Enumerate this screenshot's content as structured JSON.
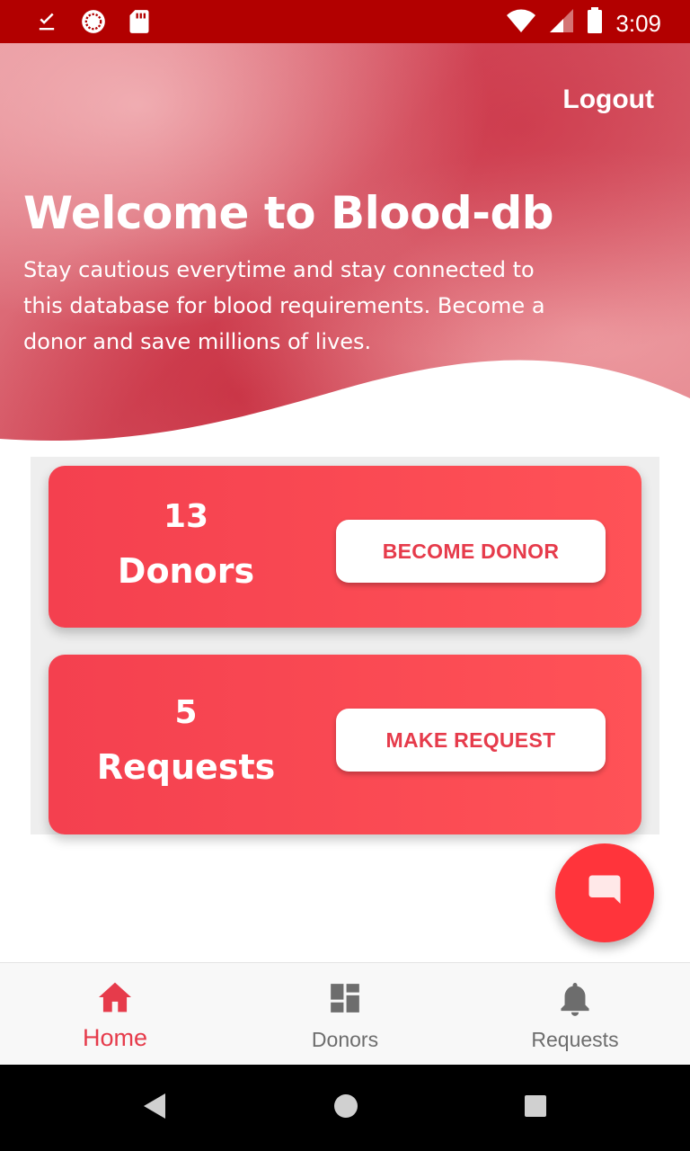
{
  "status_bar": {
    "time": "3:09",
    "icons": [
      "download-done-icon",
      "sync-icon",
      "sd-card-icon",
      "wifi-icon",
      "signal-icon",
      "battery-icon"
    ]
  },
  "hero": {
    "logout_label": "Logout",
    "title": "Welcome to Blood-db",
    "subtitle": "Stay cautious everytime and stay connected to this database for blood requirements. Become a donor and save millions of lives."
  },
  "cards": {
    "donors": {
      "count": "13",
      "label": "Donors",
      "button_label": "BECOME DONOR"
    },
    "requests": {
      "count": "5",
      "label": "Requests",
      "button_label": "MAKE REQUEST"
    }
  },
  "fab": {
    "icon": "chat-icon"
  },
  "bottom_nav": {
    "items": [
      {
        "label": "Home",
        "icon": "home-icon",
        "active": true
      },
      {
        "label": "Donors",
        "icon": "dashboard-icon",
        "active": false
      },
      {
        "label": "Requests",
        "icon": "bell-icon",
        "active": false
      }
    ]
  },
  "colors": {
    "status_bar": "#b20000",
    "accent": "#e63b4b",
    "card": "#f4404f",
    "fab": "#ff343b"
  }
}
